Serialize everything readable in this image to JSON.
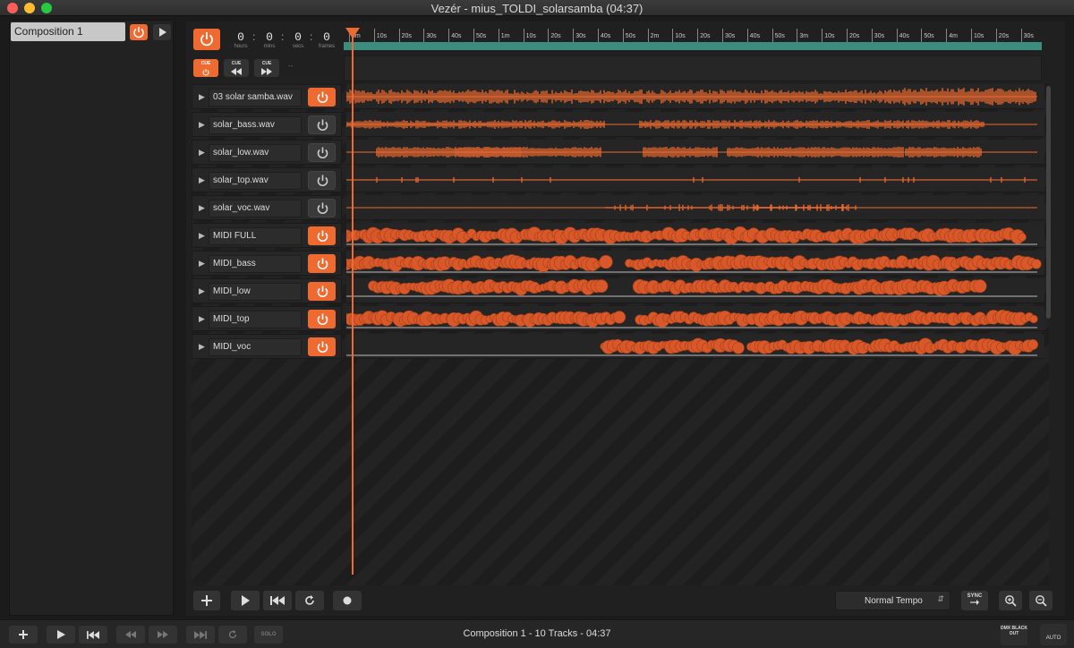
{
  "window": {
    "title": "Vezér - mius_TOLDI_solarsamba (04:37)"
  },
  "sidebar": {
    "composition_name": "Composition 1"
  },
  "timecode": {
    "hours": "0",
    "mins": "0",
    "secs": "0",
    "frames": "0",
    "labels": {
      "hours": "hours",
      "mins": "mins",
      "secs": "secs",
      "frames": "frames"
    }
  },
  "ruler": {
    "labels": [
      "0m",
      "10s",
      "20s",
      "30s",
      "40s",
      "50s",
      "1m",
      "10s",
      "20s",
      "30s",
      "40s",
      "50s",
      "2m",
      "10s",
      "20s",
      "30s",
      "40s",
      "50s",
      "3m",
      "10s",
      "20s",
      "30s",
      "40s",
      "50s",
      "4m",
      "10s",
      "20s",
      "30s"
    ]
  },
  "cue": {
    "cue_label": "CUE",
    "extra": "--"
  },
  "tracks": [
    {
      "name": "03 solar samba.wav",
      "power_on": true
    },
    {
      "name": "solar_bass.wav",
      "power_on": false
    },
    {
      "name": "solar_low.wav",
      "power_on": false
    },
    {
      "name": "solar_top.wav",
      "power_on": false
    },
    {
      "name": "solar_voc.wav",
      "power_on": false
    },
    {
      "name": "MIDI FULL",
      "power_on": true
    },
    {
      "name": "MIDI_bass",
      "power_on": true
    },
    {
      "name": "MIDI_low",
      "power_on": true
    },
    {
      "name": "MIDI_top",
      "power_on": true
    },
    {
      "name": "MIDI_voc",
      "power_on": true
    }
  ],
  "transport": {
    "tempo": "Normal Tempo",
    "sync_label": "SYNC"
  },
  "statusbar": {
    "text": "Composition 1 - 10 Tracks - 04:37",
    "solo_label": "SOLO",
    "dmx_label": "DMX BLACK OUT",
    "auto_label": "AUTO"
  },
  "colors": {
    "accent": "#ef6a31",
    "ruler": "#3d8d7f",
    "background": "#1b1b1b"
  }
}
